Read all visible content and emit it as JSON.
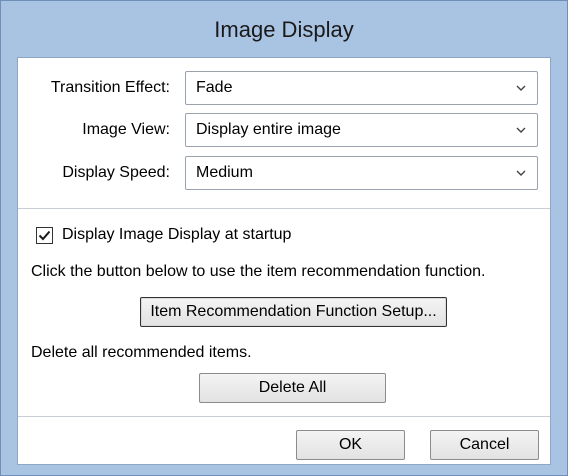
{
  "dialog": {
    "title": "Image Display",
    "fields": [
      {
        "label": "Transition Effect:",
        "value": "Fade"
      },
      {
        "label": "Image View:",
        "value": "Display entire image"
      },
      {
        "label": "Display Speed:",
        "value": "Medium"
      }
    ],
    "startup_checkbox": {
      "label": "Display Image Display at startup",
      "checked": true
    },
    "recommend_info": "Click the button below to use the item recommendation function.",
    "setup_button": "Item Recommendation Function Setup...",
    "delete_info": "Delete all recommended items.",
    "delete_button": "Delete All",
    "ok_button": "OK",
    "cancel_button": "Cancel"
  },
  "icons": {
    "dropdown": "chevron-down-icon",
    "check": "checkmark-icon"
  },
  "colors": {
    "frame": "#a9c3e3",
    "client": "#ffffff",
    "separator": "#c9ced6"
  }
}
